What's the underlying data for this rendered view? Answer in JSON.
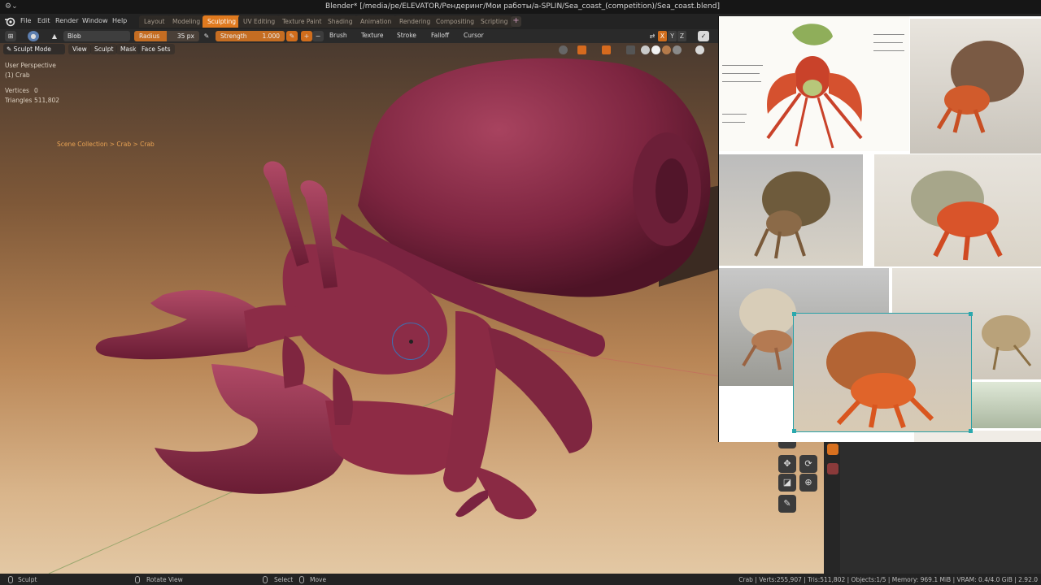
{
  "window": {
    "title": "Blender* [/media/pe/ELEVATOR/Рендеринг/Мои работы/a-SPLIN/Sea_coast_(competition)/Sea_coast.blend]"
  },
  "menu": {
    "items": [
      "File",
      "Edit",
      "Render",
      "Window",
      "Help"
    ]
  },
  "workspaces": {
    "tabs": [
      "Layout",
      "Modeling",
      "Sculpting",
      "UV Editing",
      "Texture Paint",
      "Shading",
      "Animation",
      "Rendering",
      "Compositing",
      "Scripting"
    ],
    "active": "Sculpting",
    "add_label": "+"
  },
  "tool_settings": {
    "brush_name": "Blob",
    "radius_label": "Radius",
    "radius_value": "35 px",
    "strength_label": "Strength",
    "strength_value": "1.000",
    "strength_fill": 1.0,
    "radius_fill": 0.5,
    "dropdowns": [
      "Brush",
      "Texture",
      "Stroke",
      "Falloff",
      "Cursor"
    ],
    "axis_buttons": [
      "X",
      "Y",
      "Z"
    ],
    "active_axis": "X"
  },
  "viewport": {
    "mode": "Sculpt Mode",
    "menus": [
      "View",
      "Sculpt",
      "Mask",
      "Face Sets"
    ],
    "perspective": "User Perspective",
    "object": "(1) Crab",
    "stats": {
      "vertices_label": "Vertices",
      "vertices_value": "0",
      "triangles_label": "Triangles",
      "triangles_value": "511,802"
    },
    "breadcrumb": "Scene Collection  >  Crab  >  Crab"
  },
  "reference_board": {
    "images": [
      "hermit-crab-diagram",
      "hermit-crab-photo-1",
      "hermit-crab-photo-2",
      "hermit-crab-photo-3",
      "hermit-crab-photo-4",
      "hermit-crab-photo-5",
      "hermit-crab-photo-selected"
    ]
  },
  "status": {
    "left_label": "Sculpt",
    "rotate_label": "Rotate View",
    "select_label": "Select",
    "move_label": "Move",
    "stats_line": "Crab | Verts:255,907 | Tris:511,802 | Objects:1/5 | Memory: 969.1 MiB | VRAM: 0.4/4.0 GiB | 2.92.0"
  },
  "colors": {
    "accent": "#e07a1f",
    "selection": "#29a0a6",
    "model": "#8e2b45"
  }
}
